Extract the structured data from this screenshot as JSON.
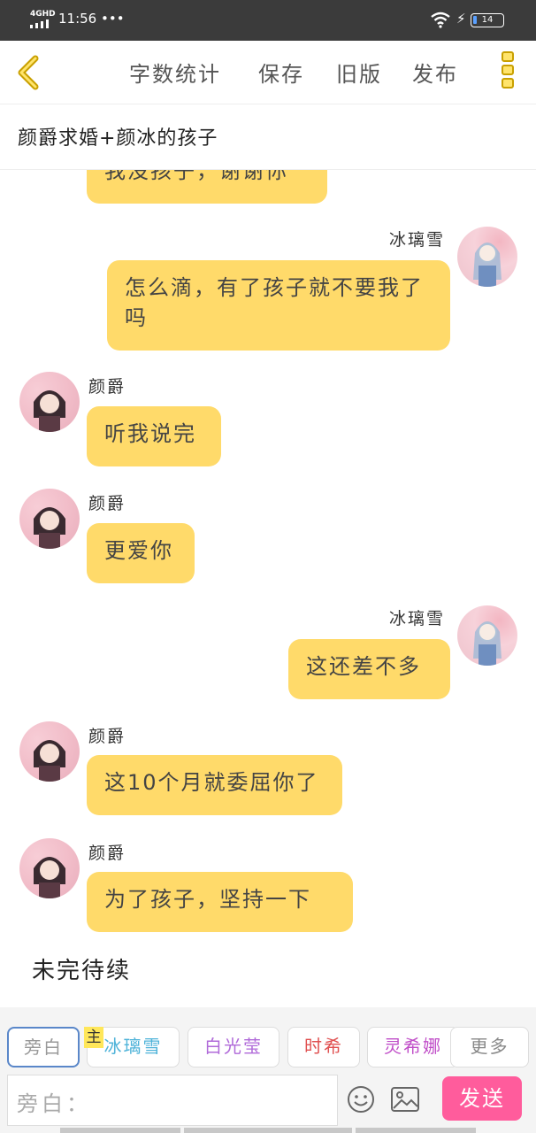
{
  "status": {
    "network": "4GHD",
    "time": "11:56",
    "more": "•••",
    "battery": "14"
  },
  "toolbar": {
    "word_count": "字数统计",
    "save": "保存",
    "old_version": "旧版",
    "publish": "发布"
  },
  "page": {
    "title": "颜爵求婚+颜冰的孩子"
  },
  "messages": [
    {
      "side": "left",
      "text": "我没孩子，谢谢你"
    },
    {
      "side": "right",
      "name": "冰璃雪",
      "text": "怎么滴，有了孩子就不要我了吗"
    },
    {
      "side": "left",
      "name": "颜爵",
      "text": "听我说完"
    },
    {
      "side": "left",
      "name": "颜爵",
      "text": "更爱你"
    },
    {
      "side": "right",
      "name": "冰璃雪",
      "text": "这还差不多"
    },
    {
      "side": "left",
      "name": "颜爵",
      "text": "这10个月就委屈你了"
    },
    {
      "side": "left",
      "name": "颜爵",
      "text": "为了孩子，坚持一下"
    }
  ],
  "narration_end": "未完待续",
  "characters": [
    {
      "label": "旁白",
      "color": "#999999"
    },
    {
      "label": "冰璃雪",
      "color": "#4fb3d9",
      "badge": "主"
    },
    {
      "label": "白光莹",
      "color": "#b06ad9"
    },
    {
      "label": "时希",
      "color": "#e05050"
    },
    {
      "label": "灵希娜",
      "color": "#c04ec8"
    },
    {
      "label": "更多",
      "color": "#888888"
    }
  ],
  "composer": {
    "placeholder": "旁白：",
    "send": "发送"
  },
  "colors": {
    "bubble": "#ffda6a",
    "accent": "#ff5c9c",
    "status_bar": "#3b3b3b"
  }
}
